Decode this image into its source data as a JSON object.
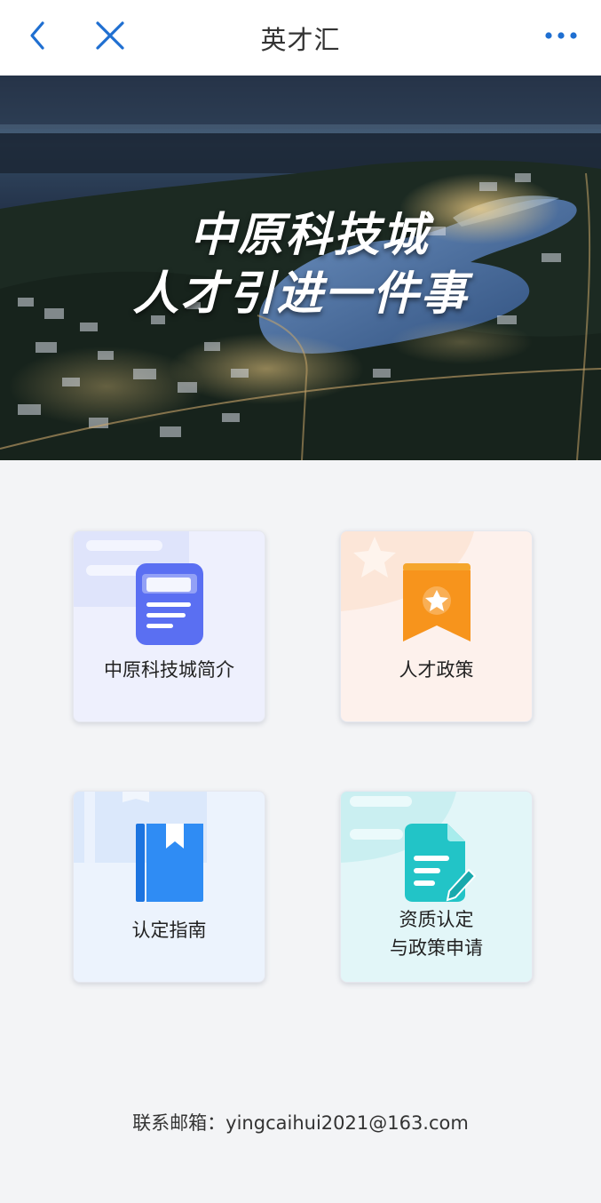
{
  "header": {
    "title": "英才汇",
    "back_icon": "chevron-left-icon",
    "close_icon": "close-icon",
    "more_icon": "more-dots-icon",
    "accent_color": "#1f6fd1"
  },
  "banner": {
    "line1": "中原科技城",
    "line2": "人才引进一件事"
  },
  "cards": [
    {
      "label": "中原科技城简介",
      "icon": "document-icon",
      "color": "#5a6ff2"
    },
    {
      "label": "人才政策",
      "icon": "star-ribbon-icon",
      "color": "#f7981c"
    },
    {
      "label": "认定指南",
      "icon": "bookmark-book-icon",
      "color": "#2f8cf4"
    },
    {
      "label_line1": "资质认定",
      "label_line2": "与政策申请",
      "icon": "edit-document-icon",
      "color": "#22c4c7"
    }
  ],
  "footer": {
    "contact": "联系邮箱：yingcaihui2021@163.com"
  }
}
